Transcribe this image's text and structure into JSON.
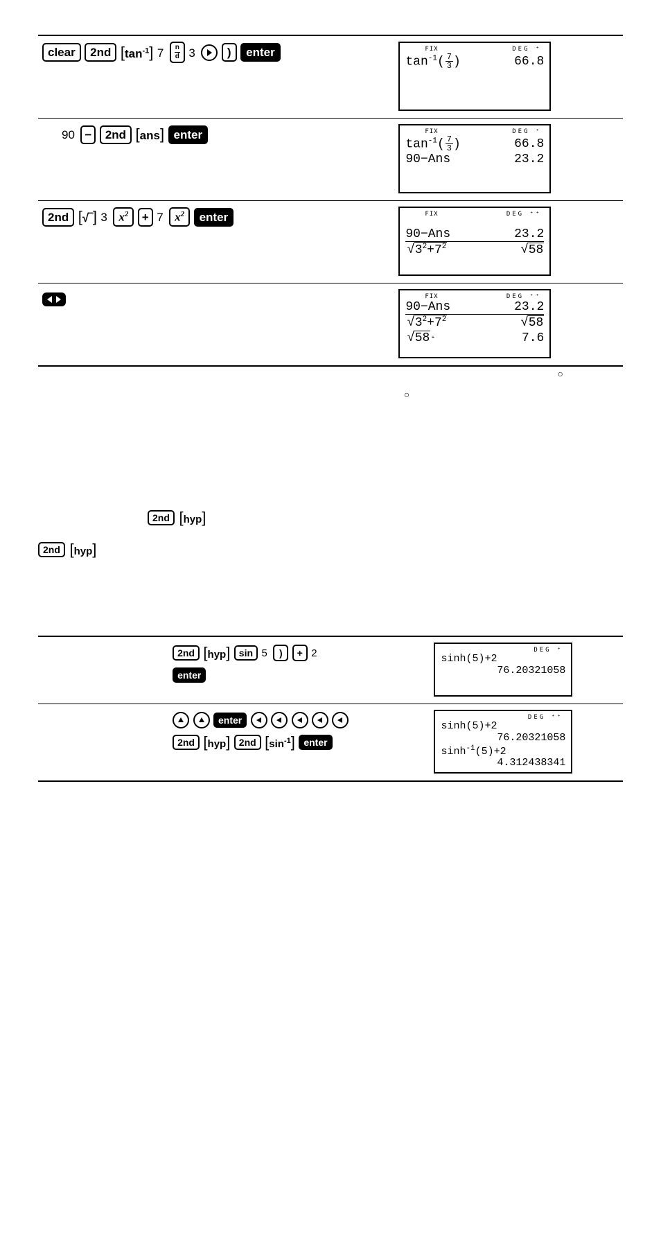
{
  "table1": {
    "rows": [
      {
        "keys_desc": "clear 2nd [tan⁻¹] 7 n/d 3 ▸ ) enter",
        "lcd": {
          "status_left": "FIX",
          "status_right": "DEG  ⁺",
          "lines": [
            {
              "left_prefix": "tan",
              "left_inv": "-1",
              "left_paren": true,
              "frac_top": "7",
              "frac_bot": "3",
              "right": "66.8"
            }
          ]
        }
      },
      {
        "keys_desc": "90 − 2nd [ans] enter",
        "plain_prefix": "90",
        "lcd": {
          "status_left": "FIX",
          "status_right": "DEG  ⁺",
          "lines": [
            {
              "left_prefix": "tan",
              "left_inv": "-1",
              "left_paren": true,
              "frac_top": "7",
              "frac_bot": "3",
              "right": "66.8"
            },
            {
              "left_plain": "90−Ans",
              "right": "23.2"
            }
          ]
        }
      },
      {
        "keys_desc": "2nd [√] 3 x² + 7 x² enter",
        "lcd": {
          "status_left": "FIX",
          "status_right": "DEG  ⁺⁺",
          "lines": [
            {
              "left_plain": "90−Ans",
              "right": "23.2",
              "border": true
            },
            {
              "left_sqrt": "3²+7²",
              "right_sqrt": "58"
            }
          ]
        }
      },
      {
        "keys_desc": "◂▸ (toggle)",
        "lcd": {
          "status_left": "FIX",
          "status_right": "DEG  ⁺⁺",
          "lines": [
            {
              "left_plain": "90−Ans",
              "right": "23.2",
              "border": true
            },
            {
              "left_sqrt": "3²+7²",
              "right_sqrt": "58"
            },
            {
              "left_sqrt_plain": "58",
              "left_suffix": "⁺",
              "right": "7.6"
            }
          ]
        }
      }
    ]
  },
  "markers": {
    "circle_right": "○",
    "circle_left": "○"
  },
  "prose": {
    "title_keys": "2nd [hyp]",
    "line_keys": "2nd [hyp]"
  },
  "table2": {
    "rows": [
      {
        "left_text": "",
        "keys_desc": "2nd [hyp] sin 5 ) + 2 enter",
        "lcd": {
          "status_left": "",
          "status_right": "DEG  ⁺",
          "lines": [
            {
              "left_plain": "sinh(5)+2",
              "right": ""
            },
            {
              "left_plain": "",
              "right": "76.20321058"
            }
          ]
        }
      },
      {
        "left_text": "",
        "keys_desc": "▲▲ enter ◂◂◂◂◂ 2nd [hyp] 2nd [sin⁻¹] enter",
        "lcd": {
          "status_left": "",
          "status_right": "DEG  ⁺⁺",
          "lines": [
            {
              "left_plain": "sinh(5)+2",
              "right": ""
            },
            {
              "left_plain": "",
              "right": "76.20321058"
            },
            {
              "left_plain_inv": "sinh",
              "inv_sup": "-1",
              "left_suffix_text": "(5)+2",
              "right": ""
            },
            {
              "left_plain": "",
              "right": "4.312438341"
            }
          ]
        }
      }
    ]
  },
  "labels": {
    "clear": "clear",
    "second": "2nd",
    "tan_inv": "tan⁻¹",
    "seven": "7",
    "nd_n": "n",
    "nd_d": "d",
    "three": "3",
    "right_arrow": "▸",
    "close_paren": ")",
    "enter": "enter",
    "ninety": "90",
    "minus": "−",
    "ans": "ans",
    "sqrt": "√‾",
    "x2": "x²",
    "plus": "+",
    "five": "5",
    "two": "2",
    "hyp": "hyp",
    "sin": "sin",
    "sin_inv": "sin⁻¹",
    "up": "▲",
    "left": "◂"
  }
}
